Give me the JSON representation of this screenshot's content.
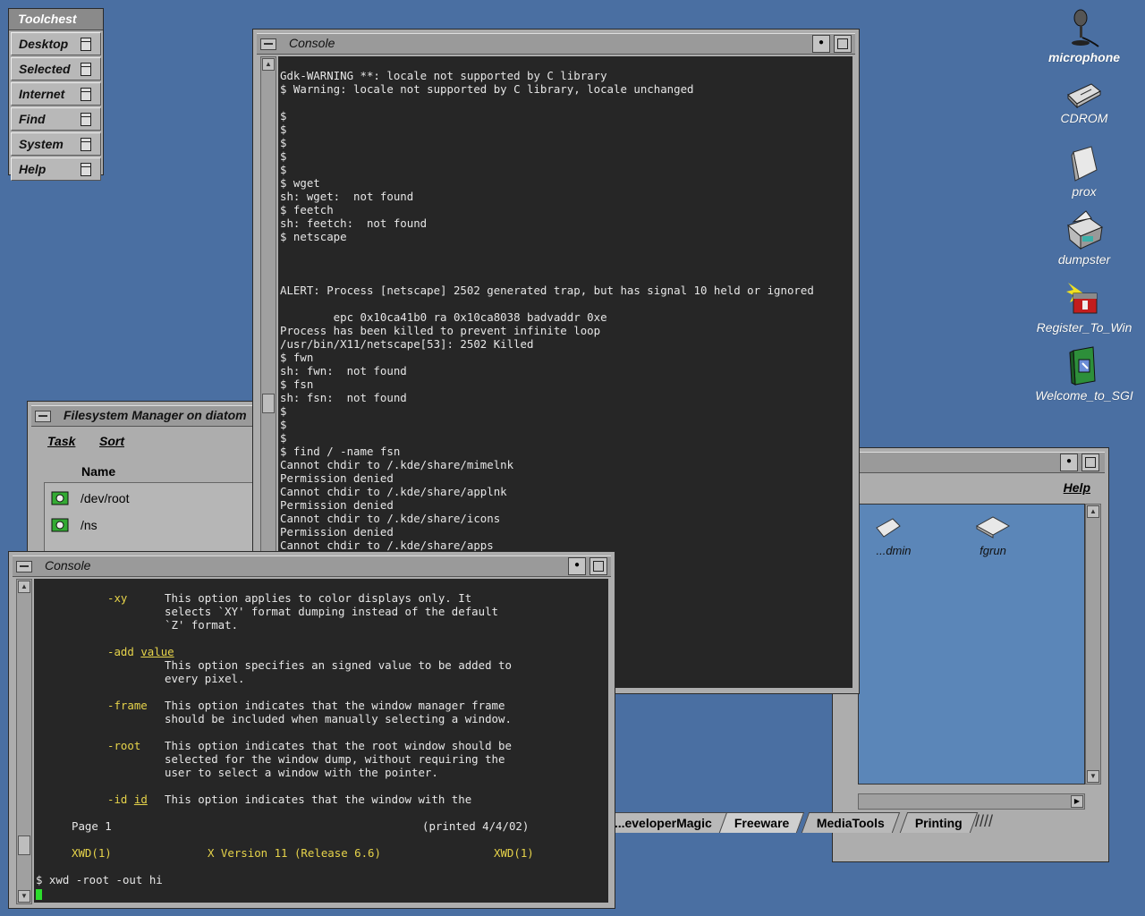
{
  "toolchest": {
    "title": "Toolchest",
    "items": [
      "Desktop",
      "Selected",
      "Internet",
      "Find",
      "System",
      "Help"
    ]
  },
  "desktop_icons": [
    {
      "label": "microphone",
      "icon": "microphone-icon"
    },
    {
      "label": "CDROM",
      "icon": "cdrom-icon"
    },
    {
      "label": "prox",
      "icon": "folder-icon"
    },
    {
      "label": "dumpster",
      "icon": "dumpster-icon"
    },
    {
      "label": "Register_To_Win",
      "icon": "register-icon"
    },
    {
      "label": "Welcome_to_SGI",
      "icon": "welcome-icon"
    }
  ],
  "console_main": {
    "title": "Console",
    "lines": [
      "Gdk-WARNING **: locale not supported by C library",
      "$ Warning: locale not supported by C library, locale unchanged",
      "",
      "$",
      "$",
      "$",
      "$",
      "$",
      "$ wget",
      "sh: wget:  not found",
      "$ feetch",
      "sh: feetch:  not found",
      "$ netscape",
      "",
      "",
      "",
      "ALERT: Process [netscape] 2502 generated trap, but has signal 10 held or ignored",
      "",
      "        epc 0x10ca41b0 ra 0x10ca8038 badvaddr 0xe",
      "Process has been killed to prevent infinite loop",
      "/usr/bin/X11/netscape[53]: 2502 Killed",
      "$ fwn",
      "sh: fwn:  not found",
      "$ fsn",
      "sh: fsn:  not found",
      "$",
      "$",
      "$",
      "$ find / -name fsn",
      "Cannot chdir to /.kde/share/mimelnk",
      "Permission denied",
      "Cannot chdir to /.kde/share/applnk",
      "Permission denied",
      "Cannot chdir to /.kde/share/icons",
      "Permission denied",
      "Cannot chdir to /.kde/share/apps"
    ]
  },
  "fs_manager": {
    "title": "Filesystem Manager on diatom",
    "menu": [
      "Task",
      "Sort"
    ],
    "column_header": "Name",
    "rows": [
      "/dev/root",
      "/ns"
    ]
  },
  "icon_catalog": {
    "help_menu": "Help",
    "icons": [
      "...dmin",
      "fgrun"
    ],
    "tabs": [
      "...eveloperMagic",
      "Freeware",
      "MediaTools",
      "Printing"
    ]
  },
  "console_man": {
    "title": "Console",
    "opt_xy": "-xy",
    "opt_xy_desc": [
      "This option applies to color displays only. It",
      "selects `XY' format dumping instead of the default",
      "`Z' format."
    ],
    "opt_add": "-add",
    "opt_add_arg": "value",
    "opt_add_desc": [
      "This option specifies an signed value to be added to",
      "every pixel."
    ],
    "opt_frame": "-frame",
    "opt_frame_desc": [
      "This option indicates that the window manager frame",
      "should be included when manually selecting a window."
    ],
    "opt_root": "-root",
    "opt_root_desc": [
      "This option indicates that the root window should be",
      "selected for the window dump, without requiring the",
      "user to select a window with the pointer."
    ],
    "opt_id": "-id",
    "opt_id_arg": "id",
    "opt_id_desc": "This option indicates that the window with the",
    "page": "Page 1",
    "printed": "(printed 4/4/02)",
    "footer_left": "XWD(1)",
    "footer_center": "X Version 11 (Release 6.6)",
    "footer_right": "XWD(1)",
    "prompt": "$ xwd -root -out hi"
  }
}
